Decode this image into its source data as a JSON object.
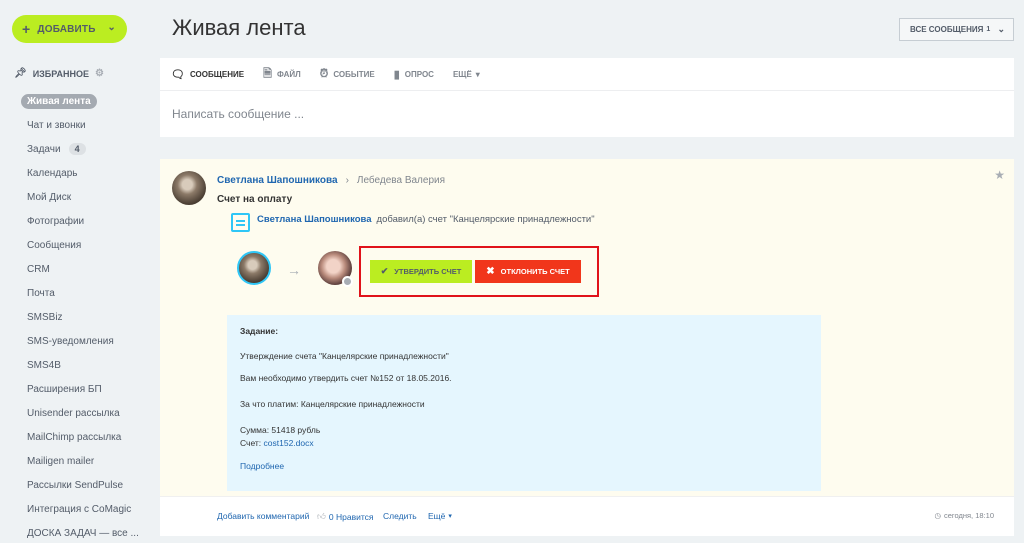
{
  "sidebar": {
    "add_button": "ДОБАВИТЬ",
    "favorites_label": "ИЗБРАННОЕ",
    "items": [
      {
        "label": "Живая лента",
        "active": true
      },
      {
        "label": "Чат и звонки"
      },
      {
        "label": "Задачи",
        "badge": "4"
      },
      {
        "label": "Календарь"
      },
      {
        "label": "Мой Диск"
      },
      {
        "label": "Фотографии"
      },
      {
        "label": "Сообщения"
      },
      {
        "label": "CRM"
      },
      {
        "label": "Почта"
      },
      {
        "label": "SMSBiz"
      },
      {
        "label": "SMS-уведомления"
      },
      {
        "label": "SMS4B"
      },
      {
        "label": "Расширения БП"
      },
      {
        "label": "Unisender рассылка"
      },
      {
        "label": "MailChimp рассылка"
      },
      {
        "label": "Mailigen mailer"
      },
      {
        "label": "Рассылки SendPulse"
      },
      {
        "label": "Интеграция с CoMagic"
      },
      {
        "label": "ДОСКА ЗАДАЧ — все ..."
      }
    ]
  },
  "header": {
    "title": "Живая лента",
    "filter_label": "ВСЕ СООБЩЕНИЯ",
    "filter_count": "1"
  },
  "composer": {
    "tabs": [
      "СООБЩЕНИЕ",
      "ФАЙЛ",
      "СОБЫТИЕ",
      "ОПРОС",
      "ЕЩЁ"
    ],
    "placeholder": "Написать сообщение ..."
  },
  "post": {
    "author": "Светлана Шапошникова",
    "recipient": "Лебедева Валерия",
    "title": "Счет на оплату",
    "event_author": "Светлана Шапошникова",
    "event_action": "добавил(а) счет \"Канцелярские принадлежности\"",
    "approve_label": "УТВЕРДИТЬ СЧЕТ",
    "reject_label": "ОТКЛОНИТЬ СЧЕТ",
    "task": {
      "header": "Задание:",
      "line1": "Утверждение счета \"Канцелярские принадлежности\"",
      "line2": "Вам необходимо утвердить счет №152 от 18.05.2016.",
      "line3": "За что платим: Канцелярские принадлежности",
      "sum": "Сумма: 51418 рубль",
      "invoice_label": "Счет:",
      "invoice_file": "cost152.docx",
      "more": "Подробнее"
    },
    "footer": {
      "comment": "Добавить комментарий",
      "like": "0 Нравится",
      "follow": "Следить",
      "more": "Ещё",
      "time": "сегодня, 18:10"
    }
  },
  "colors": {
    "accent_green": "#bbed21",
    "reject_red": "#f1361b",
    "highlight_red": "#e0121a",
    "link_blue": "#2067b0"
  }
}
